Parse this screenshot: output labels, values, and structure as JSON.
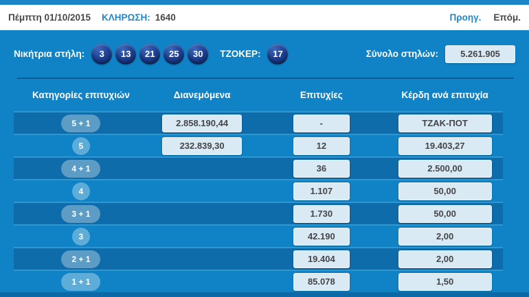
{
  "header": {
    "date": "Πέμπτη 01/10/2015",
    "draw_label": "ΚΛΗΡΩΣΗ:",
    "draw_number": "1640",
    "prev_label": "Προηγ.",
    "next_label": "Επόμ."
  },
  "winning": {
    "label": "Νικήτρια στήλη:",
    "numbers": [
      "3",
      "13",
      "21",
      "25",
      "30"
    ],
    "joker_label": "ΤΖΟΚΕΡ:",
    "joker_number": "17",
    "total_label": "Σύνολο στηλών:",
    "total_value": "5.261.905"
  },
  "table": {
    "headers": [
      "Κατηγορίες επιτυχιών",
      "Διανεμόμενα",
      "Επιτυχίες",
      "Κέρδη ανά επιτυχία"
    ],
    "rows": [
      {
        "category": "5 + 1",
        "distributed": "2.858.190,44",
        "wins": "-",
        "prize": "ΤΖΑΚ-ΠΟΤ"
      },
      {
        "category": "5",
        "distributed": "232.839,30",
        "wins": "12",
        "prize": "19.403,27"
      },
      {
        "category": "4 + 1",
        "distributed": "",
        "wins": "36",
        "prize": "2.500,00"
      },
      {
        "category": "4",
        "distributed": "",
        "wins": "1.107",
        "prize": "50,00"
      },
      {
        "category": "3 + 1",
        "distributed": "",
        "wins": "1.730",
        "prize": "50,00"
      },
      {
        "category": "3",
        "distributed": "",
        "wins": "42.190",
        "prize": "2,00"
      },
      {
        "category": "2 + 1",
        "distributed": "",
        "wins": "19.404",
        "prize": "2,00"
      },
      {
        "category": "1 + 1",
        "distributed": "",
        "wins": "85.078",
        "prize": "1,50"
      }
    ]
  },
  "colors": {
    "panel_blue": "#0f83c5",
    "dark_row_blue": "#0d6ca9",
    "top_bar_blue": "#1a86c8",
    "link_blue": "#1e88ca",
    "ball_navy": "#1d3f95",
    "value_box_fill": "#d9eaf5",
    "value_text": "#454547",
    "row_separator": "#2d98d2"
  }
}
